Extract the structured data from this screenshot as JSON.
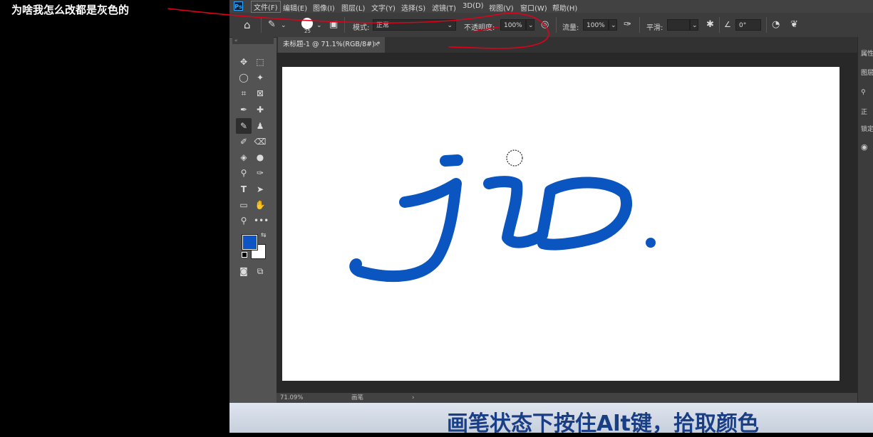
{
  "annotation": {
    "question": "为啥我怎么改都是灰色的",
    "ink_color": "#e0001b"
  },
  "menubar": {
    "logo": "Ps",
    "items": [
      "文件(F)",
      "编辑(E)",
      "图像(I)",
      "图层(L)",
      "文字(Y)",
      "选择(S)",
      "滤镜(T)",
      "3D(D)",
      "视图(V)",
      "窗口(W)",
      "帮助(H)"
    ]
  },
  "options": {
    "brush_size": "25",
    "mode_label": "模式:",
    "mode_value": "正常",
    "opacity_label": "不透明度:",
    "opacity_value": "100%",
    "flow_label": "流量:",
    "flow_value": "100%",
    "smoothing_label": "平滑:",
    "smoothing_value": "",
    "angle_value": "0°"
  },
  "document": {
    "tab_title": "未标题-1 @ 71.1%(RGB/8#) *",
    "close_glyph": "×",
    "zoom": "71.09%",
    "status_text": "画笔",
    "status_arrow": "›",
    "stroke_color": "#0b55c0"
  },
  "toolbar": {
    "foreground_color": "#0d55c4",
    "background_color": "#ffffff",
    "grip": "«",
    "text_tool_glyph": "T"
  },
  "right_panel": {
    "properties_label": "属性",
    "layers_label": "图层",
    "mode_short": "正",
    "lock_label": "锁定"
  },
  "subtitle": "画笔状态下按住Alt键，拾取颜色"
}
